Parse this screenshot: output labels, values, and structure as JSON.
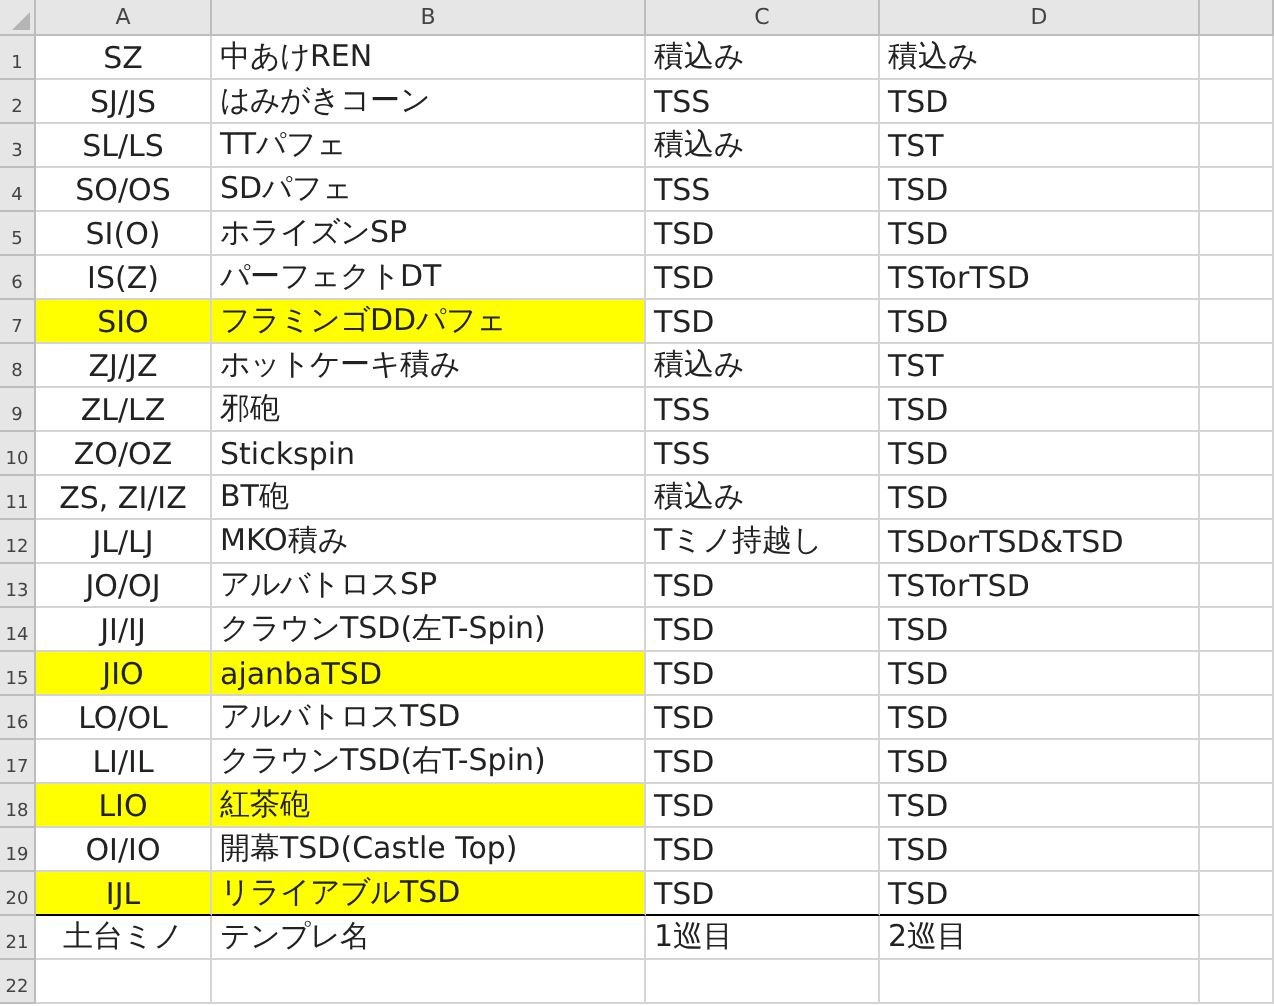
{
  "columns": [
    "A",
    "B",
    "C",
    "D"
  ],
  "rows": [
    {
      "number": "1",
      "cells": [
        "SZ",
        "中あけREN",
        "積込み",
        "積込み"
      ],
      "highlighted": false,
      "bottom_border": false
    },
    {
      "number": "2",
      "cells": [
        "SJ/JS",
        "はみがきコーン",
        "TSS",
        "TSD"
      ],
      "highlighted": false,
      "bottom_border": false
    },
    {
      "number": "3",
      "cells": [
        "SL/LS",
        "TTパフェ",
        "積込み",
        "TST"
      ],
      "highlighted": false,
      "bottom_border": false
    },
    {
      "number": "4",
      "cells": [
        "SO/OS",
        "SDパフェ",
        "TSS",
        "TSD"
      ],
      "highlighted": false,
      "bottom_border": false
    },
    {
      "number": "5",
      "cells": [
        "SI(O)",
        "ホライズンSP",
        "TSD",
        "TSD"
      ],
      "highlighted": false,
      "bottom_border": false
    },
    {
      "number": "6",
      "cells": [
        "IS(Z)",
        "パーフェクトDT",
        "TSD",
        "TSTorTSD"
      ],
      "highlighted": false,
      "bottom_border": false
    },
    {
      "number": "7",
      "cells": [
        "SIO",
        "フラミンゴDDパフェ",
        "TSD",
        "TSD"
      ],
      "highlighted": true,
      "bottom_border": false
    },
    {
      "number": "8",
      "cells": [
        "ZJ/JZ",
        "ホットケーキ積み",
        "積込み",
        "TST"
      ],
      "highlighted": false,
      "bottom_border": false
    },
    {
      "number": "9",
      "cells": [
        "ZL/LZ",
        "邪砲",
        "TSS",
        "TSD"
      ],
      "highlighted": false,
      "bottom_border": false
    },
    {
      "number": "10",
      "cells": [
        "ZO/OZ",
        "Stickspin",
        "TSS",
        "TSD"
      ],
      "highlighted": false,
      "bottom_border": false
    },
    {
      "number": "11",
      "cells": [
        "ZS, ZI/IZ",
        "BT砲",
        "積込み",
        "TSD"
      ],
      "highlighted": false,
      "bottom_border": false
    },
    {
      "number": "12",
      "cells": [
        "JL/LJ",
        "MKO積み",
        "Tミノ持越し",
        "TSDorTSD&TSD"
      ],
      "highlighted": false,
      "bottom_border": false
    },
    {
      "number": "13",
      "cells": [
        "JO/OJ",
        "アルバトロスSP",
        "TSD",
        "TSTorTSD"
      ],
      "highlighted": false,
      "bottom_border": false
    },
    {
      "number": "14",
      "cells": [
        "JI/IJ",
        "クラウンTSD(左T-Spin)",
        "TSD",
        "TSD"
      ],
      "highlighted": false,
      "bottom_border": false
    },
    {
      "number": "15",
      "cells": [
        "JIO",
        "ajanbaTSD",
        "TSD",
        "TSD"
      ],
      "highlighted": true,
      "bottom_border": false
    },
    {
      "number": "16",
      "cells": [
        "LO/OL",
        "アルバトロスTSD",
        "TSD",
        "TSD"
      ],
      "highlighted": false,
      "bottom_border": false
    },
    {
      "number": "17",
      "cells": [
        "LI/IL",
        "クラウンTSD(右T-Spin)",
        "TSD",
        "TSD"
      ],
      "highlighted": false,
      "bottom_border": false
    },
    {
      "number": "18",
      "cells": [
        "LIO",
        "紅茶砲",
        "TSD",
        "TSD"
      ],
      "highlighted": true,
      "bottom_border": false
    },
    {
      "number": "19",
      "cells": [
        "OI/IO",
        "開幕TSD(Castle Top)",
        "TSD",
        "TSD"
      ],
      "highlighted": false,
      "bottom_border": false
    },
    {
      "number": "20",
      "cells": [
        "IJL",
        "リライアブルTSD",
        "TSD",
        "TSD"
      ],
      "highlighted": true,
      "bottom_border": true
    },
    {
      "number": "21",
      "cells": [
        "土台ミノ",
        "テンプレ名",
        "1巡目",
        "2巡目"
      ],
      "highlighted": false,
      "bottom_border": false
    },
    {
      "number": "22",
      "highlighted": false,
      "bottom_border": false
    }
  ]
}
